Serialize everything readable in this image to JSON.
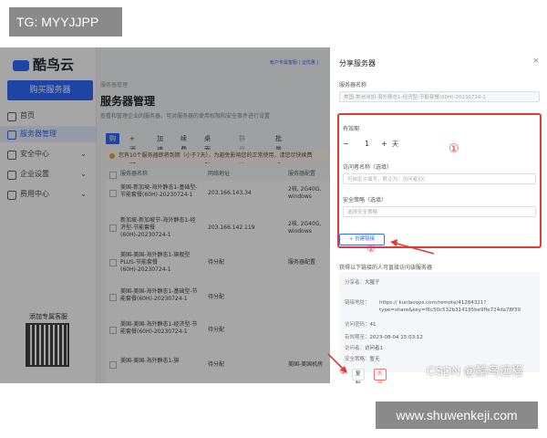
{
  "watermark_top": "TG: MYYJJPP",
  "watermark_bottom": "www.shuwenkeji.com",
  "watermark_csdn": "CSDN @酷鸟远程",
  "app": {
    "logo_text": "酷鸟云",
    "buy_button": "购买服务器",
    "top_links": "帐户专属客服   |   证优惠  |"
  },
  "sidebar": {
    "items": [
      {
        "label": "首页",
        "chevron": ""
      },
      {
        "label": "服务器管理",
        "chevron": ""
      },
      {
        "label": "安全中心",
        "chevron": "⌄"
      },
      {
        "label": "企业设置",
        "chevron": "⌄"
      },
      {
        "label": "费用中心",
        "chevron": "⌄"
      }
    ],
    "qr_label": "添加专属客服"
  },
  "main": {
    "breadcrumb": "服务器管理",
    "title": "服务器管理",
    "description": "查看和管理企业的服务器，可对服务器的使用权限和安全事件进行设置",
    "toolbar": [
      "购买",
      "+ 添加",
      "加 速",
      "续 费",
      "桌面群控",
      "群组管理",
      "批量导入"
    ],
    "warning": "您有10个服务器即将到期（小于7天），为避免影响您的正常使用，请您尽快续费",
    "headers": [
      "服务器名称",
      "网络地址",
      "服务器配置"
    ],
    "rows": [
      {
        "name": "美国-新加坡-海外静态1-基础型-节能套餐(60H)-20230724-1",
        "ip": "203.166.143.34",
        "config": "2核, 2G40G, windows"
      },
      {
        "name": "新加坡-新加坡节-海外静态1-经济型-节能套餐(60H)-20230724-1",
        "ip": "203.166.142.119",
        "config": "2核, 2G40G, windows"
      },
      {
        "name": "美国-美国-海外静态1-旗舰型PLUS-节能套餐(60H)-20230724-1",
        "ip": "待分配",
        "config": "服务器配置"
      },
      {
        "name": "美国-美国-海外静态1-基础型-节能套餐(60H)-20230724-1",
        "ip": "待分配",
        "config": ""
      },
      {
        "name": "美国-美国-海外静态1-经济型-节能套餐(60H)-20230724-1",
        "ip": "待分配",
        "config": ""
      },
      {
        "name": "美国-美国-海外静态1-旗",
        "ip": "待分配",
        "config": "美国-美国机房"
      }
    ]
  },
  "panel": {
    "title": "分享服务器",
    "close": "×",
    "server_name_label": "服务器名称",
    "server_name_value": "美国-美洲洲加-海外静态1-经济型-节能套餐(60H)-20230724-1",
    "validity_label": "有效期",
    "validity_minus": "−",
    "validity_value": "1",
    "validity_plus": "+",
    "validity_unit": "天",
    "visitor_label": "访问者名称（选填）",
    "visitor_placeholder": "可自定义填写，默认为：访问者XX",
    "policy_label": "安全策略（选填）",
    "policy_placeholder": "选择安全策略",
    "create_button": "+ 创建链接",
    "share_section_title": "获得以下链接的人可直接访问该服务器",
    "share": {
      "sharer_label": "分享者：",
      "sharer_value": "大猩子",
      "link_label": "链接地址：",
      "link_value": "https://         kunlaovps.com/remote/41284321?type=share&key=f6c50c532b314195be9ffe724da78f39",
      "code_label": "访问密码：",
      "code_value": "41",
      "expire_label": "有效期至：",
      "expire_value": "2023-08-04 15:03:12",
      "visitor_label": "访问者：",
      "visitor_value": "访问者1",
      "policy_label": "安全策略：",
      "policy_value": "暂无"
    },
    "copy_button": "复制",
    "revoke_button": "失效并删除"
  },
  "annotations": {
    "one": "①",
    "two": "②",
    "three": "③",
    "color": "#e53935"
  }
}
